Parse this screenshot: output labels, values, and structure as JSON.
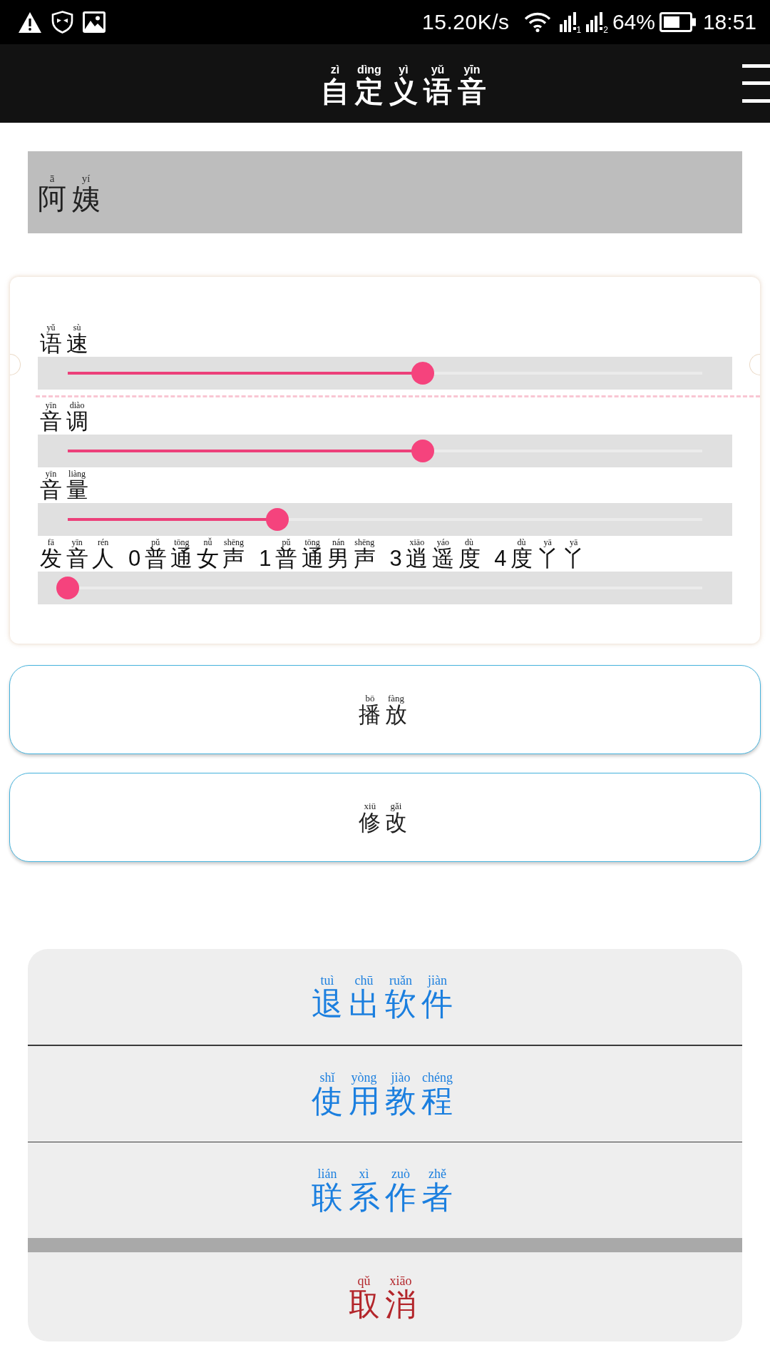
{
  "status_bar": {
    "network_speed": "15.20K/s",
    "sim_labels": [
      "1",
      "2"
    ],
    "battery": "64%",
    "time": "18:51"
  },
  "header": {
    "title": {
      "text": "自定义语音",
      "pinyin": "zì dìng yì yǔ yīn"
    }
  },
  "voice_name": {
    "text": "阿姨",
    "pinyin": "ā yí"
  },
  "sliders": [
    {
      "label": {
        "text": "语速",
        "pinyin": "yǔ sù"
      },
      "level": 0.56
    },
    {
      "label": {
        "text": "音调",
        "pinyin": "yīn diào"
      },
      "level": 0.56
    },
    {
      "label": {
        "text": "音量",
        "pinyin": "yīn liàng"
      },
      "level": 0.33
    },
    {
      "label": {
        "text": "发音人 0普通女声 1普通男声 3逍遥度 4度丫丫",
        "pinyin": "fā yīn rén pǔ tōng nǚ shēng pǔ tōng nán shēng xiāo yáo dù dù yā yā"
      },
      "level": 0
    }
  ],
  "buttons": [
    {
      "text": "播放",
      "pinyin": "bō fàng"
    },
    {
      "text": "修改",
      "pinyin": "xiū gǎi"
    }
  ],
  "action_menu": [
    {
      "kind": "normal",
      "text": "退出软件",
      "pinyin": "tuì chū ruǎn jiàn"
    },
    {
      "kind": "normal",
      "text": "使用教程",
      "pinyin": "shǐ yòng jiào chéng"
    },
    {
      "kind": "normal",
      "text": "联系作者",
      "pinyin": "lián xì zuò zhě"
    },
    {
      "kind": "cancel",
      "text": "取消",
      "pinyin": "qǔ xiāo"
    }
  ]
}
